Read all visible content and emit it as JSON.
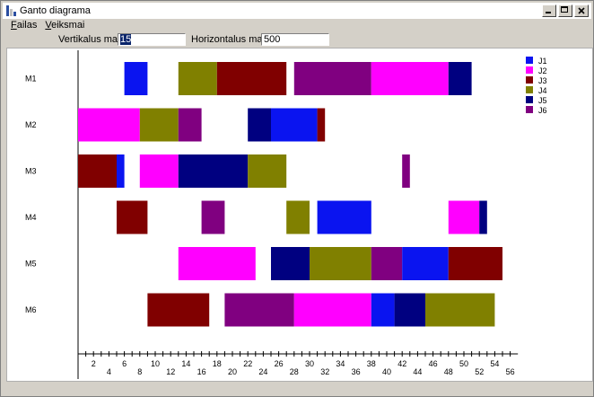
{
  "window": {
    "title": "Ganto diagrama"
  },
  "menu": [
    {
      "label": "Failas"
    },
    {
      "label": "Veiksmai"
    }
  ],
  "toolbar": {
    "vertical_label": "Vertikalus mastelis",
    "vertical_value": "15",
    "horizontal_label": "Horizontalus mastelis",
    "horizontal_value": "500"
  },
  "legend": [
    {
      "label": "J1",
      "color": "#0a14f0"
    },
    {
      "label": "J2",
      "color": "#ff00ff"
    },
    {
      "label": "J3",
      "color": "#800000"
    },
    {
      "label": "J4",
      "color": "#808000"
    },
    {
      "label": "J5",
      "color": "#000080"
    },
    {
      "label": "J6",
      "color": "#800080"
    }
  ],
  "chart_data": {
    "type": "gantt",
    "machines": [
      "M1",
      "M2",
      "M3",
      "M4",
      "M5",
      "M6"
    ],
    "x_ticks_upper": [
      "2",
      "6",
      "10",
      "14",
      "18",
      "22",
      "26",
      "30",
      "34",
      "38",
      "42",
      "46",
      "50",
      "54"
    ],
    "x_ticks_lower": [
      "4",
      "8",
      "12",
      "16",
      "20",
      "24",
      "28",
      "32",
      "36",
      "40",
      "44",
      "48",
      "52",
      "56"
    ],
    "xlim": [
      0,
      56
    ],
    "tasks": [
      {
        "machine": 0,
        "job": "J1",
        "start": 6,
        "end": 9
      },
      {
        "machine": 0,
        "job": "J4",
        "start": 13,
        "end": 18
      },
      {
        "machine": 0,
        "job": "J3",
        "start": 18,
        "end": 27
      },
      {
        "machine": 0,
        "job": "J6",
        "start": 28,
        "end": 38
      },
      {
        "machine": 0,
        "job": "J2",
        "start": 38,
        "end": 48
      },
      {
        "machine": 0,
        "job": "J5",
        "start": 48,
        "end": 51
      },
      {
        "machine": 1,
        "job": "J2",
        "start": 0,
        "end": 8
      },
      {
        "machine": 1,
        "job": "J4",
        "start": 8,
        "end": 13
      },
      {
        "machine": 1,
        "job": "J6",
        "start": 13,
        "end": 16
      },
      {
        "machine": 1,
        "job": "J5",
        "start": 22,
        "end": 25
      },
      {
        "machine": 1,
        "job": "J1",
        "start": 25,
        "end": 31
      },
      {
        "machine": 1,
        "job": "J3",
        "start": 31,
        "end": 32
      },
      {
        "machine": 2,
        "job": "J3",
        "start": 0,
        "end": 5
      },
      {
        "machine": 2,
        "job": "J1",
        "start": 5,
        "end": 6
      },
      {
        "machine": 2,
        "job": "J2",
        "start": 8,
        "end": 13
      },
      {
        "machine": 2,
        "job": "J5",
        "start": 13,
        "end": 22
      },
      {
        "machine": 2,
        "job": "J4",
        "start": 22,
        "end": 27
      },
      {
        "machine": 2,
        "job": "J6",
        "start": 42,
        "end": 43
      },
      {
        "machine": 3,
        "job": "J3",
        "start": 5,
        "end": 9
      },
      {
        "machine": 3,
        "job": "J6",
        "start": 16,
        "end": 19
      },
      {
        "machine": 3,
        "job": "J4",
        "start": 27,
        "end": 30
      },
      {
        "machine": 3,
        "job": "J1",
        "start": 31,
        "end": 38
      },
      {
        "machine": 3,
        "job": "J2",
        "start": 48,
        "end": 52
      },
      {
        "machine": 3,
        "job": "J5",
        "start": 52,
        "end": 53
      },
      {
        "machine": 4,
        "job": "J2",
        "start": 13,
        "end": 23
      },
      {
        "machine": 4,
        "job": "J5",
        "start": 25,
        "end": 30
      },
      {
        "machine": 4,
        "job": "J4",
        "start": 30,
        "end": 38
      },
      {
        "machine": 4,
        "job": "J6",
        "start": 38,
        "end": 42
      },
      {
        "machine": 4,
        "job": "J1",
        "start": 42,
        "end": 48
      },
      {
        "machine": 4,
        "job": "J3",
        "start": 48,
        "end": 55
      },
      {
        "machine": 5,
        "job": "J3",
        "start": 9,
        "end": 17
      },
      {
        "machine": 5,
        "job": "J6",
        "start": 19,
        "end": 28
      },
      {
        "machine": 5,
        "job": "J2",
        "start": 28,
        "end": 38
      },
      {
        "machine": 5,
        "job": "J1",
        "start": 38,
        "end": 41
      },
      {
        "machine": 5,
        "job": "J5",
        "start": 41,
        "end": 45
      },
      {
        "machine": 5,
        "job": "J4",
        "start": 45,
        "end": 54
      }
    ]
  }
}
